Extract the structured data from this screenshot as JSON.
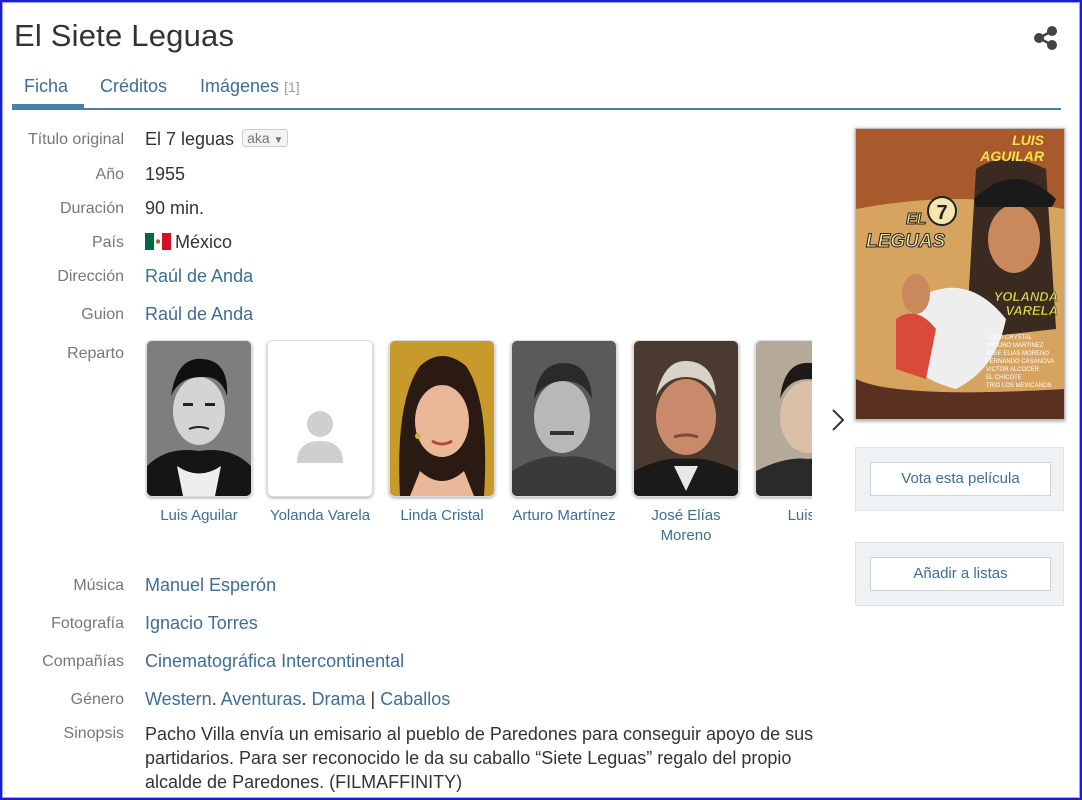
{
  "page": {
    "title": "El Siete Leguas",
    "share_icon": "share-icon"
  },
  "tabs": [
    {
      "label": "Ficha",
      "active": true
    },
    {
      "label": "Créditos",
      "active": false
    },
    {
      "label": "Imágenes",
      "count": "[1]",
      "active": false
    }
  ],
  "fields": {
    "titulo_original": {
      "label": "Título original",
      "value": "El 7 leguas",
      "aka": "aka"
    },
    "anio": {
      "label": "Año",
      "value": "1955"
    },
    "duracion": {
      "label": "Duración",
      "value": "90 min."
    },
    "pais": {
      "label": "País",
      "value": "México",
      "flag_icon": "mexico-flag-icon"
    },
    "direccion": {
      "label": "Dirección",
      "value": "Raúl de Anda"
    },
    "guion": {
      "label": "Guion",
      "value": "Raúl de Anda"
    },
    "reparto": {
      "label": "Reparto"
    },
    "musica": {
      "label": "Música",
      "value": "Manuel Esperón"
    },
    "fotografia": {
      "label": "Fotografía",
      "value": "Ignacio Torres"
    },
    "companias": {
      "label": "Compañías",
      "value": "Cinematográfica Intercontinental"
    },
    "genero": {
      "label": "Género",
      "values": [
        "Western",
        "Aventuras",
        "Drama"
      ],
      "separator": "|",
      "topic": "Caballos"
    },
    "sinopsis": {
      "label": "Sinopsis",
      "value": "Pacho Villa envía un emisario al pueblo de Paredones para conseguir apoyo de sus partidarios. Para ser reconocido le da su caballo “Siete Leguas” regalo del propio alcalde de Paredones. (FILMAFFINITY)"
    }
  },
  "cast": [
    {
      "name": "Luis Aguilar",
      "photo": "portrait"
    },
    {
      "name": "Yolanda Varela",
      "photo": "placeholder-person-icon"
    },
    {
      "name": "Linda Cristal",
      "photo": "portrait"
    },
    {
      "name": "Arturo Martínez",
      "photo": "portrait"
    },
    {
      "name": "José Elías Moreno",
      "photo": "portrait"
    },
    {
      "name": "Luis A",
      "photo": "portrait"
    }
  ],
  "poster": {
    "top_text": "LUIS AGUILAR",
    "logo": "EL 7 LEGUAS",
    "costar": "YOLANDA VARELA",
    "credits": [
      "LINDA CRYSTAL",
      "ARTURO MARTINEZ",
      "JOSE ELIAS MORENO",
      "FERNANDO CASANOVA",
      "VICTOR ALCOCER",
      "EL CHICOTE",
      "TRIO LOS MEXICANOS"
    ]
  },
  "sidebar": {
    "vote_label": "Vota esta película",
    "add_label": "Añadir a listas"
  },
  "colors": {
    "link": "#3d6e94",
    "frame": "#1c1cd8",
    "tab_underline": "#4a7fa8"
  }
}
